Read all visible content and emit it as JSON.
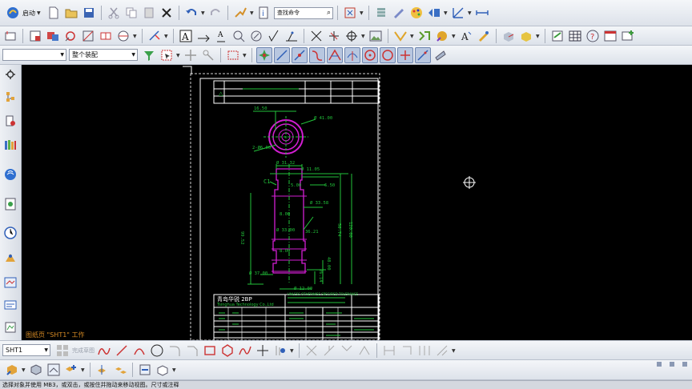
{
  "toolbar": {
    "start_label": "启动",
    "search_placeholder": "查找命令"
  },
  "selection": {
    "filter_value": "",
    "scope_value": "整个装配"
  },
  "sheet_tab": {
    "label": "图纸页 \"SHT1\" 工作"
  },
  "bottom": {
    "sheet_select": "SHT1",
    "gray_label": "完成草图"
  },
  "status": {
    "text": "选择对象并使用 MB3，或双击，或按住并拖动来移动视图。尺寸或注释"
  },
  "drawing": {
    "company_cn": "青岛华锐 2BP",
    "company_en": "Tsinghua Technology Co.,Ltd",
    "unless_note": "UNLESS OTHERWISE SPECIFIED TOLERANCE",
    "dims": {
      "d1": "16.50",
      "d2": "Ø 41.00",
      "d3": "2-Ø6.00",
      "d4": "Ø 31.32",
      "d5": "Ø 11.05",
      "d6": "C1",
      "d7": "5.00",
      "d8": "6.50",
      "d9": "Ø 33.58",
      "d10": "8.00",
      "d11": "Ø 33.00",
      "d12": "36.21",
      "d13": "56.74",
      "d14": "120.00",
      "d15": "99.52",
      "d16": "8.00",
      "d17": "48.00",
      "d18": "Ø 37.00",
      "d19": "26.14",
      "d20": "Ø 12.00"
    }
  },
  "colors": {
    "canvas_bg": "#000000",
    "sheet_frame": "#ffffff",
    "dimension": "#22c23a",
    "part_outline": "#d21ed2",
    "sheet_label": "#d58a24"
  }
}
